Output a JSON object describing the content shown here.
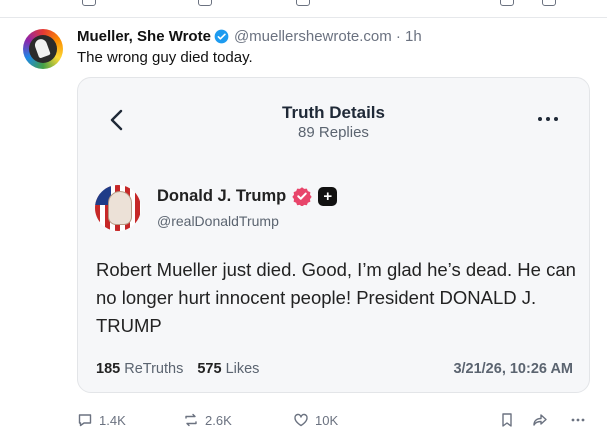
{
  "post": {
    "author_name": "Mueller, She Wrote",
    "handle_and_time": "@muellershewrote.com · 1h",
    "text": "The wrong guy died today."
  },
  "embed": {
    "title": "Truth Details",
    "subtitle": "89 Replies",
    "author_name": "Donald J. Trump",
    "author_handle": "@realDonaldTrump",
    "plus_badge": "+",
    "body": "Robert Mueller just died. Good, I’m glad he’s dead. He can no longer hurt innocent people! President DONALD J. TRUMP",
    "retruths_count": "185",
    "retruths_label": "ReTruths",
    "likes_count": "575",
    "likes_label": "Likes",
    "date": "3/21/26, 10:26 AM"
  },
  "actions": {
    "replies": "1.4K",
    "reposts": "2.6K",
    "likes": "10K"
  },
  "colors": {
    "verified_blue": "#1d9bf0",
    "truth_badge": "#e8456b",
    "icon_gray": "#6b7280"
  },
  "icons": [
    "back-chevron-icon",
    "more-dots-icon",
    "verified-badge-icon",
    "reply-icon",
    "repost-icon",
    "like-icon",
    "bookmark-icon",
    "share-icon",
    "ellipsis-icon"
  ]
}
